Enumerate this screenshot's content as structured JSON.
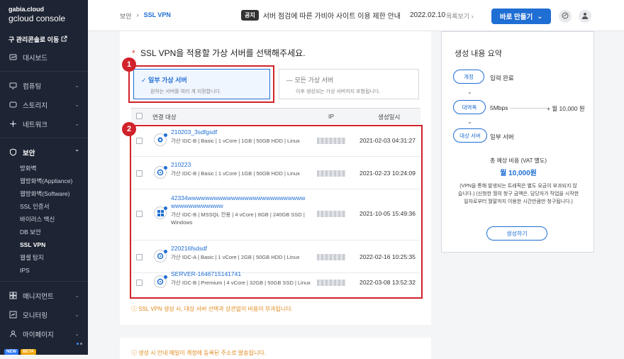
{
  "sidebar": {
    "logo_small": "gabia.cloud",
    "logo_large": "gcloud console",
    "legacy_link": "구 관리콘솔로 이동",
    "items": [
      {
        "label": "대시보드",
        "icon": "dashboard-icon"
      },
      {
        "label": "컴퓨팅",
        "icon": "monitor-icon"
      },
      {
        "label": "스토리지",
        "icon": "storage-icon"
      },
      {
        "label": "네트워크",
        "icon": "network-icon"
      },
      {
        "label": "보안",
        "icon": "shield-icon"
      }
    ],
    "security_sub": [
      "방화벽",
      "웹방화벽(Appliance)",
      "웹방화벽(Software)",
      "SSL 인증서",
      "바이러스 백신",
      "DB 보안",
      "SSL VPN",
      "웹셸 탐지",
      "IPS"
    ],
    "bottom_items": [
      {
        "label": "매니지먼트",
        "icon": "grid-icon"
      },
      {
        "label": "모니터링",
        "icon": "chart-icon"
      },
      {
        "label": "마이페이지",
        "icon": "user-icon"
      }
    ],
    "tags": [
      "NEW",
      "BETA"
    ]
  },
  "topbar": {
    "breadcrumb_parent": "보안",
    "breadcrumb_current": "SSL VPN",
    "notice_badge": "공지",
    "notice_text": "서버 점검에 따른 가비아 사이트 이용 제한 안내",
    "notice_date": "2022.02.10",
    "notice_all": "목록보기",
    "create_button": "바로 만들기"
  },
  "main": {
    "title_asterisk": "*",
    "title": "SSL VPN을 적용할 가상 서버를 선택해주세요.",
    "option_partial": {
      "label": "일부 가상 서버",
      "desc": "원하는 서버를 여러 개 지정합니다."
    },
    "option_all": {
      "label": "모든 가상 서버",
      "desc": "이후 생성되는 가상 서버까지 포함됩니다."
    },
    "table": {
      "headers": {
        "target": "연결 대상",
        "ip": "IP",
        "created": "생성일시"
      },
      "rows": [
        {
          "name": "210203_3sdfgsdf",
          "spec": "가산 IDC-B | Basic | 1 vCore | 1GB | 50GB HDD | Linux",
          "created": "2021-02-03 04:31:27",
          "os": "linux"
        },
        {
          "name": "210223",
          "spec": "가산 IDC-B | Basic | 1 vCore | 1GB | 50GB HDD | Linux",
          "created": "2021-02-23 10:24:09",
          "os": "linux"
        },
        {
          "name": "42334wwwwwwwwwwwwwwwwwwwwwwwwwwwwwwwwwwwwwww",
          "spec": "가산 IDC-B | MSSQL 전용 | 4 vCore | 8GB | 240GB SSD | Windows",
          "created": "2021-10-05 15:49:36",
          "os": "windows"
        },
        {
          "name": "220216fsdsdf",
          "spec": "가산 IDC-A | Basic | 1 vCore | 2GB | 50GB HDD | Linux",
          "created": "2022-02-16 10:25:35",
          "os": "linux"
        },
        {
          "name": "SERVER-1646715141741",
          "spec": "가산 IDC-B | Premium | 4 vCore | 32GB | 50GB SSD | Linux",
          "created": "2022-03-08 13:52:32",
          "os": "linux"
        }
      ]
    },
    "warning": "ⓘ SSL VPN 생성 시, 대상 서버 선택과 상관없이 비용이 부과됩니다.",
    "warning2": "ⓘ 생성 시 안내 메일이 계정에 등록된 주소로 발송됩니다."
  },
  "annotations": [
    "1",
    "2"
  ],
  "summary": {
    "title": "생성 내용 요약",
    "rows": [
      {
        "pill": "계정",
        "value": "입력 완료"
      },
      {
        "pill": "대역폭",
        "value": "5Mbps",
        "price": "+ 월 10,000 원"
      },
      {
        "pill": "대상 서버",
        "value": "일부 서버"
      }
    ],
    "cost_label": "총 예상 비용 (VAT 별도)",
    "cost": "월 10,000원",
    "note": "(VPN을 통해 발생되는 트래픽은 별도 요금이 부과되지 않습니다.) (신청한 월의 청구 금액은, 담당자가 작업을 시작한 일자로부터 월말까지 이용한 시간만큼만 청구됩니다.)",
    "button": "생성하기"
  }
}
